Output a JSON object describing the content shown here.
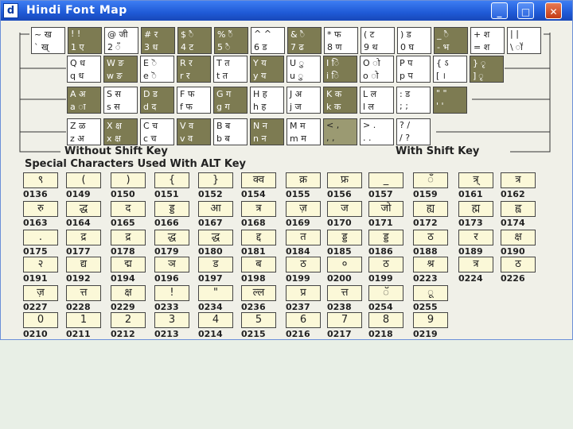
{
  "window": {
    "title": "Hindi Font Map",
    "app_icon_glyph": "d",
    "minimize_glyph": "_",
    "maximize_glyph": "□",
    "close_glyph": "✕"
  },
  "keyboard": {
    "rows": [
      [
        {
          "top": "~ ख",
          "bottom": "` ख्",
          "style": "light"
        },
        {
          "top": "!  !",
          "bottom": "1  ए",
          "style": "dark"
        },
        {
          "top": "@ जी",
          "bottom": "2  ँ",
          "style": "light"
        },
        {
          "top": "# र",
          "bottom": "3  ध",
          "style": "dark"
        },
        {
          "top": "$  ै",
          "bottom": "4  ट",
          "style": "dark"
        },
        {
          "top": "%  ैं",
          "bottom": "5  ै",
          "style": "dark"
        },
        {
          "top": "^  ^",
          "bottom": "6  ड",
          "style": "light"
        },
        {
          "top": "&  ै",
          "bottom": "7  ढ",
          "style": "dark"
        },
        {
          "top": "*  फ",
          "bottom": "8  ण",
          "style": "light"
        },
        {
          "top": "(  ट",
          "bottom": "9  थ",
          "style": "light"
        },
        {
          "top": ")  ड",
          "bottom": "0  घ",
          "style": "light"
        },
        {
          "top": "_  ै",
          "bottom": "-  भ",
          "style": "dark"
        },
        {
          "top": "+ श",
          "bottom": "=  श",
          "style": "light"
        },
        {
          "top": "|  |",
          "bottom": "\\  ॉ",
          "style": "light"
        }
      ],
      [
        {
          "top": "Q ध",
          "bottom": "q  ध",
          "style": "light"
        },
        {
          "top": "W ङ",
          "bottom": "w  ङ",
          "style": "dark"
        },
        {
          "top": "E ॆ",
          "bottom": "e  ॆ",
          "style": "light"
        },
        {
          "top": "R र",
          "bottom": "r  र",
          "style": "dark"
        },
        {
          "top": "T त",
          "bottom": "t  त",
          "style": "light"
        },
        {
          "top": "Y य",
          "bottom": "y  य",
          "style": "dark"
        },
        {
          "top": "U ु",
          "bottom": "u  ु",
          "style": "light"
        },
        {
          "top": "I ि",
          "bottom": "i  ि",
          "style": "dark"
        },
        {
          "top": "O ो",
          "bottom": "o  ो",
          "style": "light"
        },
        {
          "top": "P प",
          "bottom": "p  प",
          "style": "light"
        },
        {
          "top": "{  ऽ",
          "bottom": "[  ।",
          "style": "light"
        },
        {
          "top": "}  ृ",
          "bottom": "]  ृ",
          "style": "dark"
        }
      ],
      [
        {
          "top": "A अ",
          "bottom": "a  ा",
          "style": "dark"
        },
        {
          "top": "S स",
          "bottom": "s  स",
          "style": "light"
        },
        {
          "top": "D ड",
          "bottom": "d  द",
          "style": "dark"
        },
        {
          "top": "F फ",
          "bottom": "f  फ",
          "style": "light"
        },
        {
          "top": "G ग",
          "bottom": "g  ग",
          "style": "dark"
        },
        {
          "top": "H ह",
          "bottom": "h  ह",
          "style": "light"
        },
        {
          "top": "J अ",
          "bottom": "j  ज",
          "style": "light"
        },
        {
          "top": "K क",
          "bottom": "k  क",
          "style": "dark"
        },
        {
          "top": "L ल",
          "bottom": "l  ल",
          "style": "light"
        },
        {
          "top": ":  ड",
          "bottom": ";  ;",
          "style": "light"
        },
        {
          "top": "\"  \"",
          "bottom": "'  '",
          "style": "dark"
        }
      ],
      [
        {
          "top": "Z ळ",
          "bottom": "z  अ",
          "style": "light"
        },
        {
          "top": "X क्ष",
          "bottom": "x  क्ष",
          "style": "dark"
        },
        {
          "top": "C च",
          "bottom": "c  च",
          "style": "light"
        },
        {
          "top": "V व",
          "bottom": "v  व",
          "style": "dark"
        },
        {
          "top": "B ब",
          "bottom": "b  ब",
          "style": "light"
        },
        {
          "top": "N न",
          "bottom": "n  न",
          "style": "dark"
        },
        {
          "top": "M म",
          "bottom": "m  म",
          "style": "light"
        },
        {
          "top": "<  ,",
          "bottom": ",  ,",
          "style": "mid"
        },
        {
          "top": ">  .",
          "bottom": ".  .",
          "style": "light"
        },
        {
          "top": "?  /",
          "bottom": "/  ?",
          "style": "light"
        }
      ]
    ],
    "without_shift_label": "Without Shift Key",
    "with_shift_label": "With Shift Key"
  },
  "special": {
    "heading": "Special Characters Used With ALT Key",
    "rows": [
      [
        {
          "glyph": "९",
          "code": "0136"
        },
        {
          "glyph": "(",
          "code": "0149"
        },
        {
          "glyph": ")",
          "code": "0150"
        },
        {
          "glyph": "{",
          "code": "0151"
        },
        {
          "glyph": "}",
          "code": "0152"
        },
        {
          "glyph": "क्व",
          "code": "0154"
        },
        {
          "glyph": "क्र",
          "code": "0155"
        },
        {
          "glyph": "फ्र",
          "code": "0156"
        },
        {
          "glyph": "_",
          "code": "0157"
        },
        {
          "glyph": "ँ",
          "code": "0159"
        },
        {
          "glyph": "त्र्",
          "code": "0161"
        },
        {
          "glyph": "त्र",
          "code": "0162"
        }
      ],
      [
        {
          "glyph": "रु",
          "code": "0163"
        },
        {
          "glyph": "द्ध",
          "code": "0164"
        },
        {
          "glyph": "द",
          "code": "0165"
        },
        {
          "glyph": "ड्ड",
          "code": "0166"
        },
        {
          "glyph": "आ",
          "code": "0167"
        },
        {
          "glyph": "त्र",
          "code": "0168"
        },
        {
          "glyph": "ज़",
          "code": "0169"
        },
        {
          "glyph": "ज",
          "code": "0170"
        },
        {
          "glyph": "जो",
          "code": "0171"
        },
        {
          "glyph": "ह्य",
          "code": "0172"
        },
        {
          "glyph": "ह्म",
          "code": "0173"
        },
        {
          "glyph": "ह्व",
          "code": "0174"
        }
      ],
      [
        {
          "glyph": ".",
          "code": "0175"
        },
        {
          "glyph": "द्र",
          "code": "0177"
        },
        {
          "glyph": "द्र",
          "code": "0178"
        },
        {
          "glyph": "द्ध",
          "code": "0179"
        },
        {
          "glyph": "द्ध",
          "code": "0180"
        },
        {
          "glyph": "द्द",
          "code": "0181"
        },
        {
          "glyph": "त",
          "code": "0184"
        },
        {
          "glyph": "ड्ड",
          "code": "0185"
        },
        {
          "glyph": "ड्ड",
          "code": "0186"
        },
        {
          "glyph": "ठ",
          "code": "0188"
        },
        {
          "glyph": "र",
          "code": "0189"
        },
        {
          "glyph": "क्ष",
          "code": "0190"
        }
      ],
      [
        {
          "glyph": "२",
          "code": "0191"
        },
        {
          "glyph": "द्य",
          "code": "0192"
        },
        {
          "glyph": "द्म",
          "code": "0194"
        },
        {
          "glyph": "ञ",
          "code": "0196"
        },
        {
          "glyph": "ड",
          "code": "0197"
        },
        {
          "glyph": "ब",
          "code": "0198"
        },
        {
          "glyph": "ठ",
          "code": "0199"
        },
        {
          "glyph": "०",
          "code": "0200"
        },
        {
          "glyph": "ठ",
          "code": "0199"
        },
        {
          "glyph": "श्र",
          "code": "0223"
        },
        {
          "glyph": "त्र",
          "code": "0224"
        },
        {
          "glyph": "ठ",
          "code": "0226"
        }
      ],
      [
        {
          "glyph": "ज़",
          "code": "0227"
        },
        {
          "glyph": "त्त",
          "code": "0228"
        },
        {
          "glyph": "क्ष",
          "code": "0229"
        },
        {
          "glyph": "!",
          "code": "0233"
        },
        {
          "glyph": "\"",
          "code": "0234"
        },
        {
          "glyph": "ल्ल",
          "code": "0236"
        },
        {
          "glyph": "प्र",
          "code": "0237"
        },
        {
          "glyph": "त्त",
          "code": "0238"
        },
        {
          "glyph": "ॅ",
          "code": "0254"
        },
        {
          "glyph": "ू",
          "code": "0255"
        }
      ],
      [
        {
          "glyph": "0",
          "code": "0210"
        },
        {
          "glyph": "1",
          "code": "0211"
        },
        {
          "glyph": "2",
          "code": "0212"
        },
        {
          "glyph": "3",
          "code": "0213"
        },
        {
          "glyph": "4",
          "code": "0214"
        },
        {
          "glyph": "5",
          "code": "0215"
        },
        {
          "glyph": "6",
          "code": "0216"
        },
        {
          "glyph": "7",
          "code": "0217"
        },
        {
          "glyph": "8",
          "code": "0218"
        },
        {
          "glyph": "9",
          "code": "0219"
        }
      ]
    ]
  }
}
